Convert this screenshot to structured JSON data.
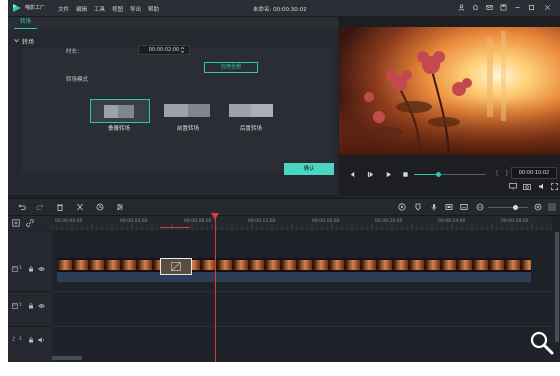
{
  "app": {
    "brand": "喵影工厂",
    "title": "未命名: 00:00:30:02"
  },
  "menu": [
    "文件",
    "编辑",
    "工具",
    "视图",
    "导出",
    "帮助"
  ],
  "edit_panel": {
    "tab": "转场",
    "section": "转场",
    "duration_label": "时长：",
    "duration_value": "00:00:02:00",
    "apply_all": "应用全部",
    "mode_label": "转场模式",
    "modes": [
      "叠覆转场",
      "前置转场",
      "后置转场"
    ],
    "selected_mode": "叠覆转场",
    "ok": "确认"
  },
  "preview": {
    "timecode": "00:00:10:02"
  },
  "timeline": {
    "ruler_ticks": [
      "00:00:00:00",
      "00:00:04:00",
      "00:00:08:00",
      "00:00:12:00",
      "00:00:16:00",
      "00:00:20:00",
      "00:00:24:00",
      "00:00:28:00"
    ],
    "tracks": [
      {
        "index": "1",
        "type": "video"
      },
      {
        "index": "1",
        "type": "video"
      },
      {
        "index": "1",
        "type": "audio"
      }
    ]
  },
  "colors": {
    "accent": "#2fc6b1",
    "playhead": "#e03a3a",
    "background": "#1f2228"
  }
}
